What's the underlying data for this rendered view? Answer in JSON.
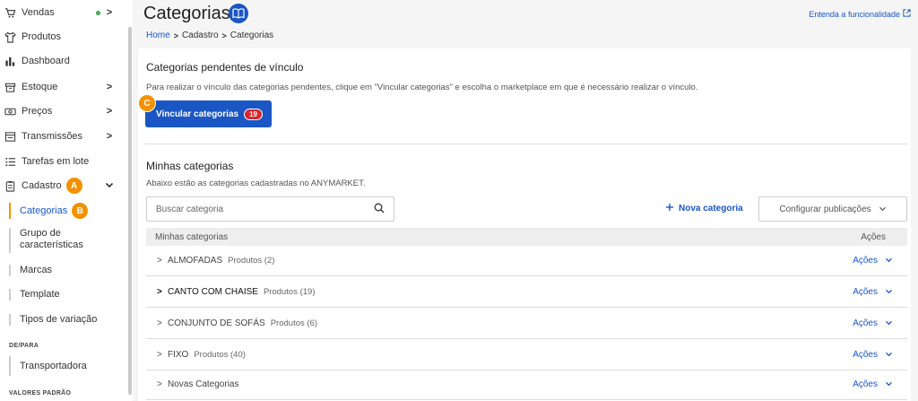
{
  "sidebar": {
    "items": [
      {
        "label": "Vendas",
        "icon": "cart-icon",
        "chevron": ">",
        "dot": true
      },
      {
        "label": "Produtos",
        "icon": "shirt-icon"
      },
      {
        "label": "Dashboard",
        "icon": "bar-chart-icon"
      },
      {
        "label": "Estoque",
        "icon": "box-icon",
        "chevron": ">"
      },
      {
        "label": "Preços",
        "icon": "money-icon",
        "chevron": ">"
      },
      {
        "label": "Transmissões",
        "icon": "transmission-icon",
        "chevron": ">"
      },
      {
        "label": "Tarefas em lote",
        "icon": "list-icon"
      },
      {
        "label": "Cadastro",
        "icon": "clipboard-icon",
        "chevron": "⌄",
        "badge": "A"
      }
    ],
    "cadastro_sub": [
      {
        "label": "Categorias",
        "badge": "B"
      },
      {
        "label": "Grupo de características"
      },
      {
        "label": "Marcas"
      },
      {
        "label": "Template"
      },
      {
        "label": "Tipos de variação"
      }
    ],
    "sections": {
      "depara": "DE/PARA",
      "valores": "VALORES PADRÃO"
    },
    "depara_items": [
      "Transportadora"
    ]
  },
  "header": {
    "title": "Categorias",
    "feature_link": "Entenda a funcionalidade",
    "breadcrumb": [
      "Home",
      "Cadastro",
      "Categorias"
    ]
  },
  "pending": {
    "title": "Categorias pendentes de vínculo",
    "description": "Para realizar o vínculo das categorias pendentes, clique em \"Vincular categorias\" e escolha o marketplace em que é necessário realizar o vínculo.",
    "button_label": "Vincular categorias",
    "button_count": "19",
    "step_badge": "C"
  },
  "mine": {
    "title": "Minhas categorias",
    "description": "Abaixo estão as categorias cadastradas no ANYMARKET.",
    "search_placeholder": "Buscar categoria",
    "new_label": "Nova categoria",
    "config_label": "Configurar publicações",
    "col_name": "Minhas categorias",
    "col_actions": "Ações",
    "rows": [
      {
        "name": "ALMOFADAS",
        "count": "Produtos (2)",
        "bold": false,
        "actions": "Ações"
      },
      {
        "name": "CANTO COM CHAISE",
        "count": "Produtos (19)",
        "bold": true,
        "actions": "Ações"
      },
      {
        "name": "CONJUNTO DE SOFÁS",
        "count": "Produtos (6)",
        "bold": false,
        "actions": "Ações"
      },
      {
        "name": "FIXO",
        "count": "Produtos (40)",
        "bold": false,
        "actions": "Ações"
      },
      {
        "name": "Novas Categorias",
        "count": "",
        "bold": false,
        "actions": "Ações"
      }
    ]
  },
  "colors": {
    "accent": "#1a56c4",
    "step_badge": "#f39200",
    "count_badge": "#d8262e"
  }
}
